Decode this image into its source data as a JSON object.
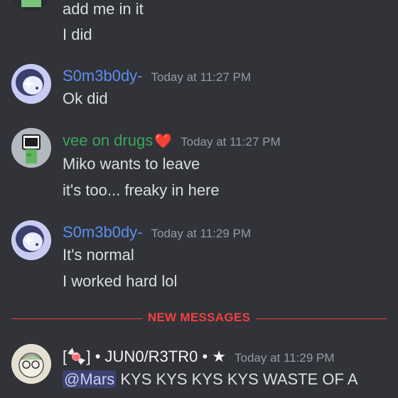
{
  "messages_top": {
    "line1": "add me in it",
    "line2": "I did"
  },
  "msg1": {
    "author": "S0m3b0dy-",
    "author_color": "#5b8ef0",
    "timestamp": "Today at 11:27 PM",
    "lines": [
      "Ok did"
    ]
  },
  "msg2": {
    "author": "vee on drugs",
    "author_color": "#3ba55c",
    "heart": "❤️",
    "timestamp": "Today at 11:27 PM",
    "lines": [
      "Miko wants to leave",
      "it's too... freaky in here"
    ]
  },
  "msg3": {
    "author": "S0m3b0dy-",
    "author_color": "#5b8ef0",
    "timestamp": "Today at 11:29 PM",
    "lines": [
      "It's normal",
      "I worked hard lol"
    ]
  },
  "divider": {
    "label": "NEW MESSAGES"
  },
  "msg4": {
    "author_prefix": "[🍬] • ",
    "author": "JUN0/R3TR0",
    "author_suffix": " • ★",
    "timestamp": "Today at 11:29 PM",
    "mention": "@Mars",
    "text": " KYS KYS KYS KYS WASTE OF A"
  }
}
